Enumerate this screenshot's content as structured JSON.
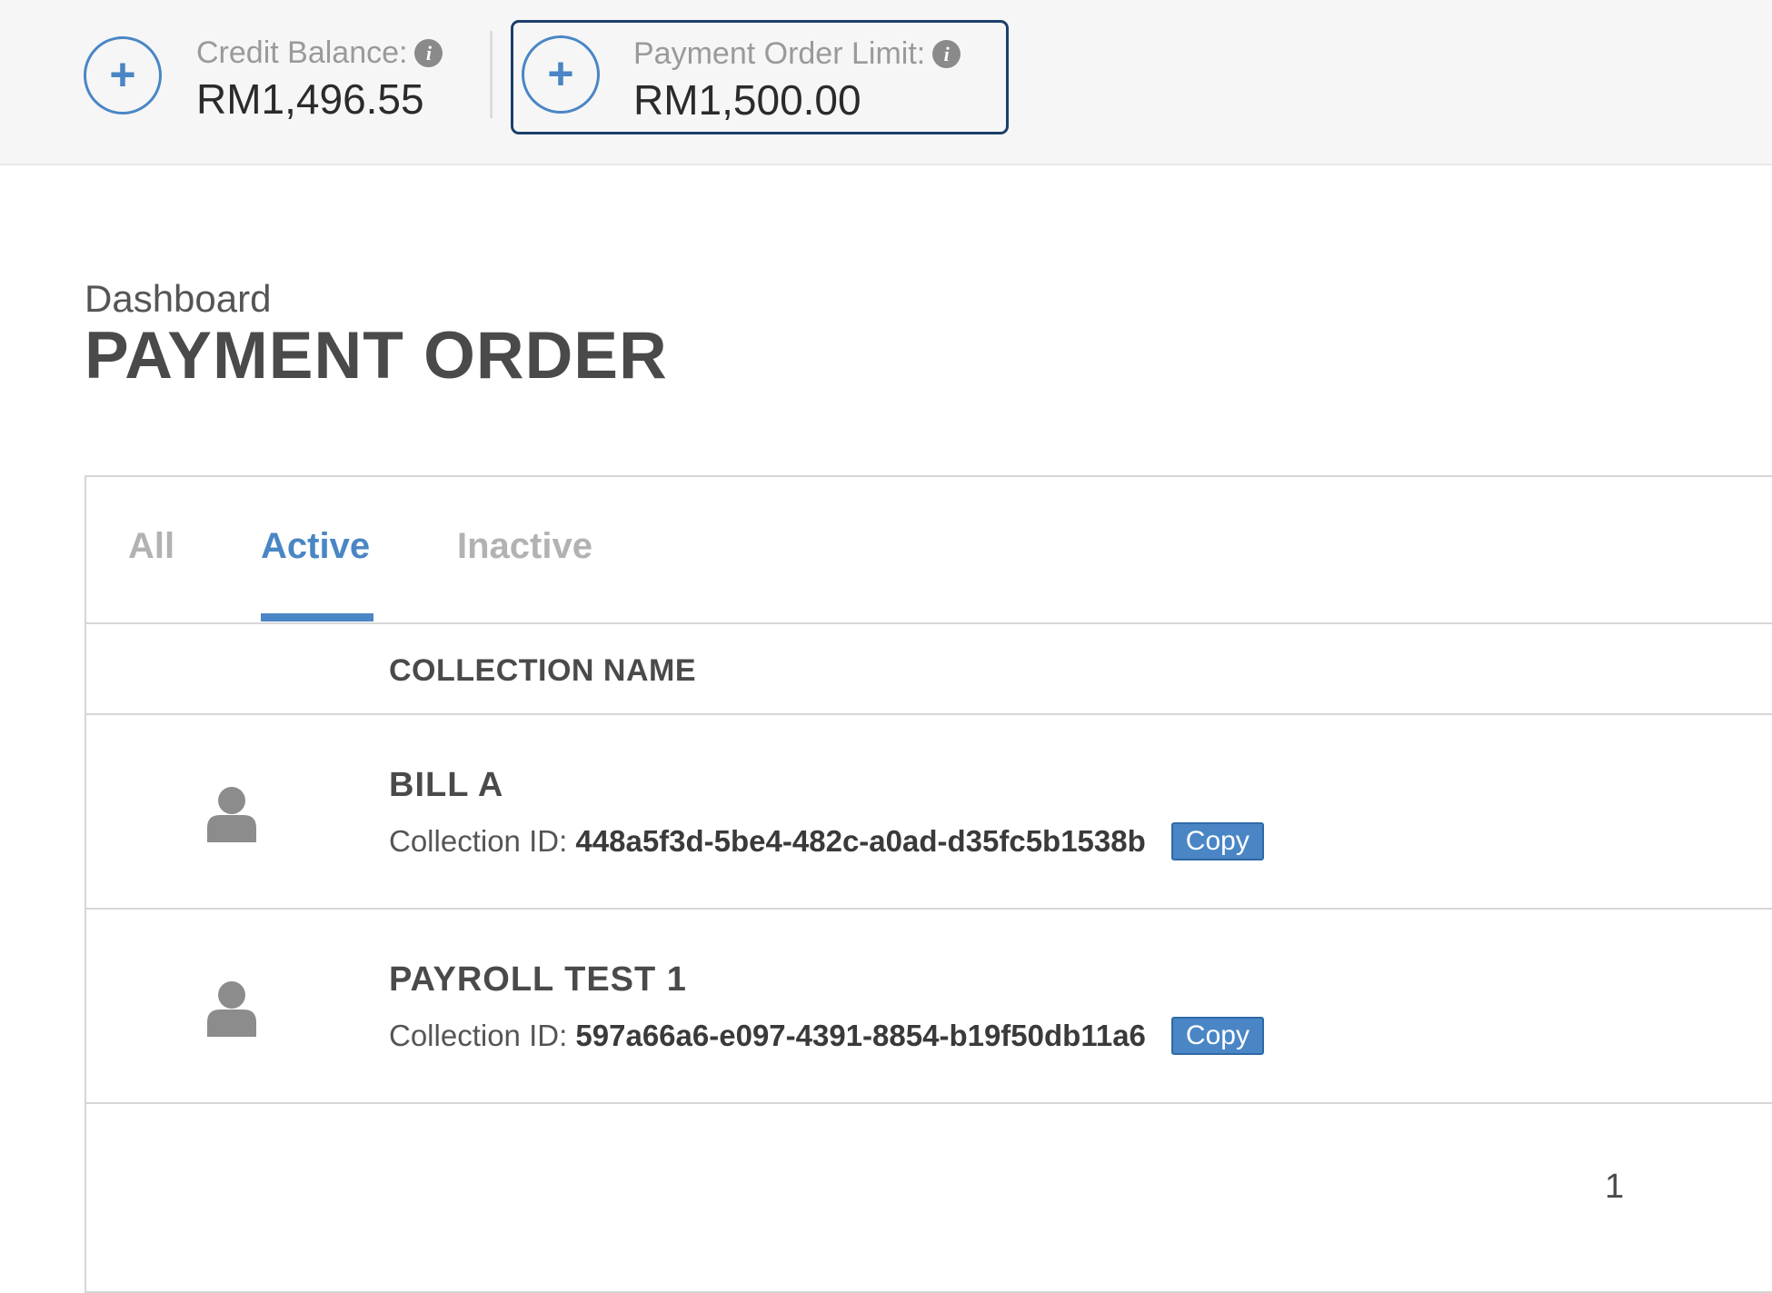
{
  "balances": {
    "credit": {
      "label": "Credit Balance:",
      "value": "RM1,496.55"
    },
    "limit": {
      "label": "Payment Order Limit:",
      "value": "RM1,500.00"
    },
    "plus_glyph": "+",
    "info_glyph": "i"
  },
  "header": {
    "breadcrumb": "Dashboard",
    "title": "PAYMENT ORDER"
  },
  "tabs": [
    {
      "label": "All",
      "active": false
    },
    {
      "label": "Active",
      "active": true
    },
    {
      "label": "Inactive",
      "active": false
    }
  ],
  "table": {
    "column_header": "COLLECTION NAME",
    "id_prefix": "Collection ID:",
    "rows": [
      {
        "name": "BILL A",
        "collection_id": "448a5f3d-5be4-482c-a0ad-d35fc5b1538b",
        "copy_label": "Copy",
        "icon": "user-icon"
      },
      {
        "name": "PAYROLL TEST 1",
        "collection_id": "597a66a6-e097-4391-8854-b19f50db11a6",
        "copy_label": "Copy",
        "icon": "user-icon"
      }
    ]
  },
  "pagination": {
    "current_page": "1"
  },
  "colors": {
    "accent": "#4a86c5",
    "highlight_border": "#1d3f6a"
  }
}
